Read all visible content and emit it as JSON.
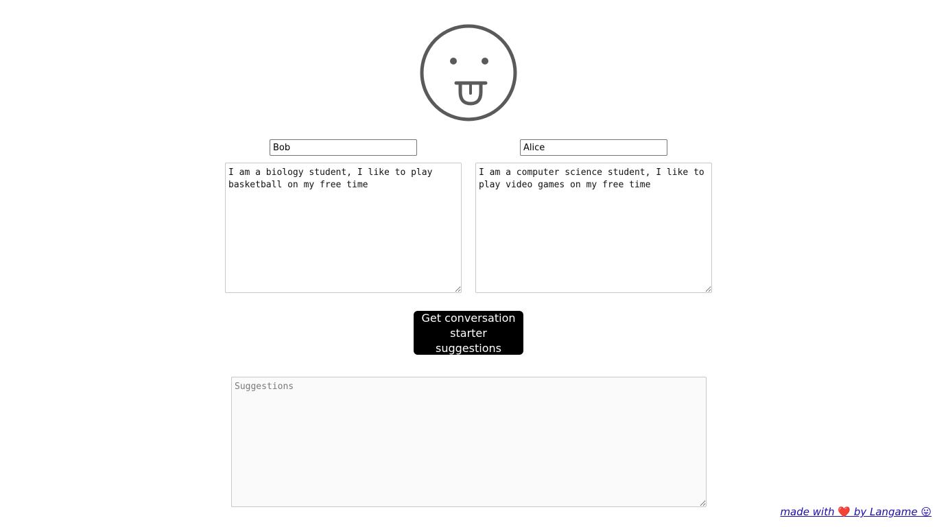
{
  "logo": {
    "icon": "tongue-out-face-icon",
    "stroke_color": "#5a5a5a"
  },
  "person_a": {
    "name": "Bob",
    "bio": "I am a biology student, I like to play basketball on my free time"
  },
  "person_b": {
    "name": "Alice",
    "bio": "I am a computer science student, I like to play video games on my free time"
  },
  "action": {
    "label": "Get conversation starter suggestions",
    "bg_color": "#000000"
  },
  "suggestions": {
    "placeholder": "Suggestions",
    "value": ""
  },
  "footer": {
    "text_before": "made with ",
    "heart": "❤️",
    "text_after": " by Langame ",
    "emoji": "😛"
  }
}
